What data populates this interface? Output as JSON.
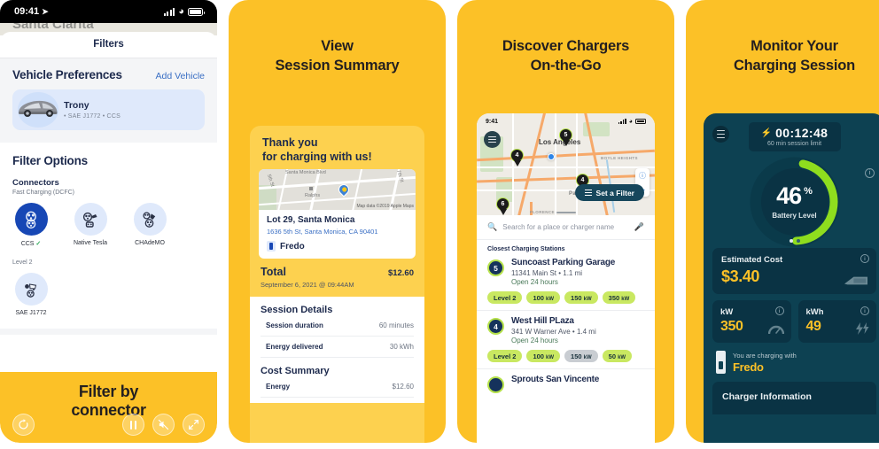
{
  "panel1": {
    "statusbar": {
      "time": "09:41",
      "location_arrow": "location-arrow-icon",
      "signal": "cellular-signal-icon",
      "wifi": "wifi-icon",
      "battery": "battery-icon"
    },
    "peek_map_label": "Santa Clarita",
    "sheet_title": "Filters",
    "vehicle_section": {
      "heading": "Vehicle Preferences",
      "add_link": "Add Vehicle",
      "vehicle_name": "Trony",
      "vehicle_connectors": "• SAE J1772 • CCS"
    },
    "filter_options_heading": "Filter Options",
    "connectors_heading": "Connectors",
    "fast_charging_label": "Fast Charging (DCFC)",
    "fast_connectors": [
      {
        "label": "CCS",
        "selected": true,
        "check": "✓"
      },
      {
        "label": "Native Tesla",
        "selected": false,
        "check": ""
      },
      {
        "label": "CHAdeMO",
        "selected": false,
        "check": ""
      }
    ],
    "level2_label": "Level 2",
    "level2_connectors": [
      {
        "label": "SAE J1772",
        "selected": false,
        "check": ""
      }
    ],
    "player": {
      "caption_line1": "Filter by",
      "caption_line2": "connector",
      "replay": "replay-icon",
      "pause": "pause-icon",
      "mute": "mute-icon",
      "fullscreen": "fullscreen-icon"
    }
  },
  "panel2": {
    "title_line1": "View",
    "title_line2": "Session Summary",
    "thank_line1": "Thank you",
    "thank_line2": "for charging with us!",
    "map": {
      "credit": "Map data ©2019 Apple Maps",
      "poi": "Ralphs",
      "street_top": "Santa Monica Blvd",
      "street_left": "5th St",
      "street_right": "7th St"
    },
    "location_name": "Lot 29, Santa Monica",
    "location_address": "1636 5th St, Santa Monica, CA 90401",
    "charger_name": "Fredo",
    "total_label": "Total",
    "total_value": "$12.60",
    "total_date": "September 6, 2021 @ 09:44AM",
    "session_details_heading": "Session Details",
    "session_details": [
      {
        "key": "Session duration",
        "value": "60 minutes"
      },
      {
        "key": "Energy delivered",
        "value": "30 kWh"
      }
    ],
    "cost_summary_heading": "Cost Summary",
    "cost_summary": [
      {
        "key": "Energy",
        "value": "$12.60"
      }
    ]
  },
  "panel3": {
    "title_line1": "Discover Chargers",
    "title_line2": "On-the-Go",
    "statusbar_time": "9:41",
    "map": {
      "city": "Los Angeles",
      "area1": "BOYLE HEIGHTS",
      "area2": "FLORENCE",
      "area3": "Park",
      "markers": [
        "5",
        "4",
        "4",
        "6"
      ]
    },
    "set_filter_label": "Set a Filter",
    "search_placeholder": "Search for a place or charger name",
    "closest_heading": "Closest Charging Stations",
    "stations": [
      {
        "badge": "5",
        "name": "Suncoast Parking Garage",
        "address": "11341 Main St • 1.1 mi",
        "hours": "Open 24 hours",
        "chips": [
          {
            "label": "Level 2",
            "unit": "",
            "off": false
          },
          {
            "label": "100",
            "unit": "kW",
            "off": false
          },
          {
            "label": "150",
            "unit": "kW",
            "off": false
          },
          {
            "label": "350",
            "unit": "kW",
            "off": false
          }
        ]
      },
      {
        "badge": "4",
        "name": "West Hill PLaza",
        "address": "341 W Warner Ave • 1.4 mi",
        "hours": "Open 24 hours",
        "chips": [
          {
            "label": "Level 2",
            "unit": "",
            "off": false
          },
          {
            "label": "100",
            "unit": "kW",
            "off": false
          },
          {
            "label": "150",
            "unit": "kW",
            "off": true
          },
          {
            "label": "50",
            "unit": "kW",
            "off": false
          }
        ]
      },
      {
        "badge": "",
        "name": "Sprouts San Vincente",
        "address": "",
        "hours": "",
        "chips": []
      }
    ]
  },
  "panel4": {
    "title_line1": "Monitor Your",
    "title_line2": "Charging Session",
    "timer_value": "00:12:48",
    "timer_sub": "60 min session limit",
    "battery_pct": "46",
    "battery_pct_sign": "%",
    "battery_label": "Battery Level",
    "ring_progress_pct": 46,
    "estimated_cost_label": "Estimated Cost",
    "estimated_cost_value": "$3.40",
    "kw_label": "kW",
    "kw_value": "350",
    "kwh_label": "kWh",
    "kwh_value": "49",
    "charging_with_label": "You are charging with",
    "charging_with_name": "Fredo",
    "charger_information_label": "Charger Information"
  },
  "colors": {
    "brand_yellow": "#fcc127",
    "deep_navy": "#1d2a4d",
    "teal_dark": "#0d4152",
    "teal_card": "#0a3344",
    "accent_green": "#a8e02a",
    "chip_green": "#c9e861",
    "link_blue": "#3a6fc4"
  }
}
